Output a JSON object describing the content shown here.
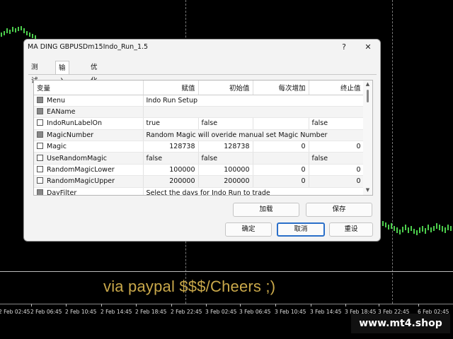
{
  "chart": {
    "promo_text": "via paypal $$$/Cheers ;)",
    "watermark": "www.mt4.shop",
    "time_labels": [
      "2 Feb 02:45",
      "2 Feb 06:45",
      "2 Feb 10:45",
      "2 Feb 14:45",
      "2 Feb 18:45",
      "2 Feb 22:45",
      "3 Feb 02:45",
      "3 Feb 06:45",
      "3 Feb 10:45",
      "3 Feb 14:45",
      "3 Feb 18:45",
      "3 Feb 22:45",
      "6 Feb 02:45"
    ]
  },
  "dialog": {
    "title": "MA DING GBPUSDm15Indo_Run_1.5",
    "help_label": "?",
    "close_label": "✕",
    "tabs": [
      "测试",
      "输入参数",
      "优化"
    ],
    "active_tab": "输入参数",
    "table": {
      "headers": [
        "变量",
        "赋值",
        "初始值",
        "每次增加",
        "终止值"
      ],
      "rows": [
        {
          "name": "Menu",
          "value": "Indo Run Setup",
          "start": "",
          "step": "",
          "stop": "",
          "span": true
        },
        {
          "name": "EAName",
          "value": "",
          "start": "",
          "step": "",
          "stop": "",
          "span": true
        },
        {
          "name": "IndoRunLabelOn",
          "value": "true",
          "start": "false",
          "step": "",
          "stop": "false",
          "span": false
        },
        {
          "name": "MagicNumber",
          "value": "Random Magic will overide manual set Magic Number",
          "start": "",
          "step": "",
          "stop": "",
          "span": true
        },
        {
          "name": "Magic",
          "value": "128738",
          "start": "128738",
          "step": "0",
          "stop": "0",
          "span": false
        },
        {
          "name": "UseRandomMagic",
          "value": "false",
          "start": "false",
          "step": "",
          "stop": "false",
          "span": false
        },
        {
          "name": "RandomMagicLower",
          "value": "100000",
          "start": "100000",
          "step": "0",
          "stop": "0",
          "span": false
        },
        {
          "name": "RandomMagicUpper",
          "value": "200000",
          "start": "200000",
          "step": "0",
          "stop": "0",
          "span": false
        },
        {
          "name": "DayFilter",
          "value": "Select the days for Indo Run to trade",
          "start": "",
          "step": "",
          "stop": "",
          "span": true
        }
      ]
    },
    "buttons": {
      "load": "加载",
      "save": "保存",
      "ok": "确定",
      "cancel": "取消",
      "reset": "重设"
    }
  }
}
